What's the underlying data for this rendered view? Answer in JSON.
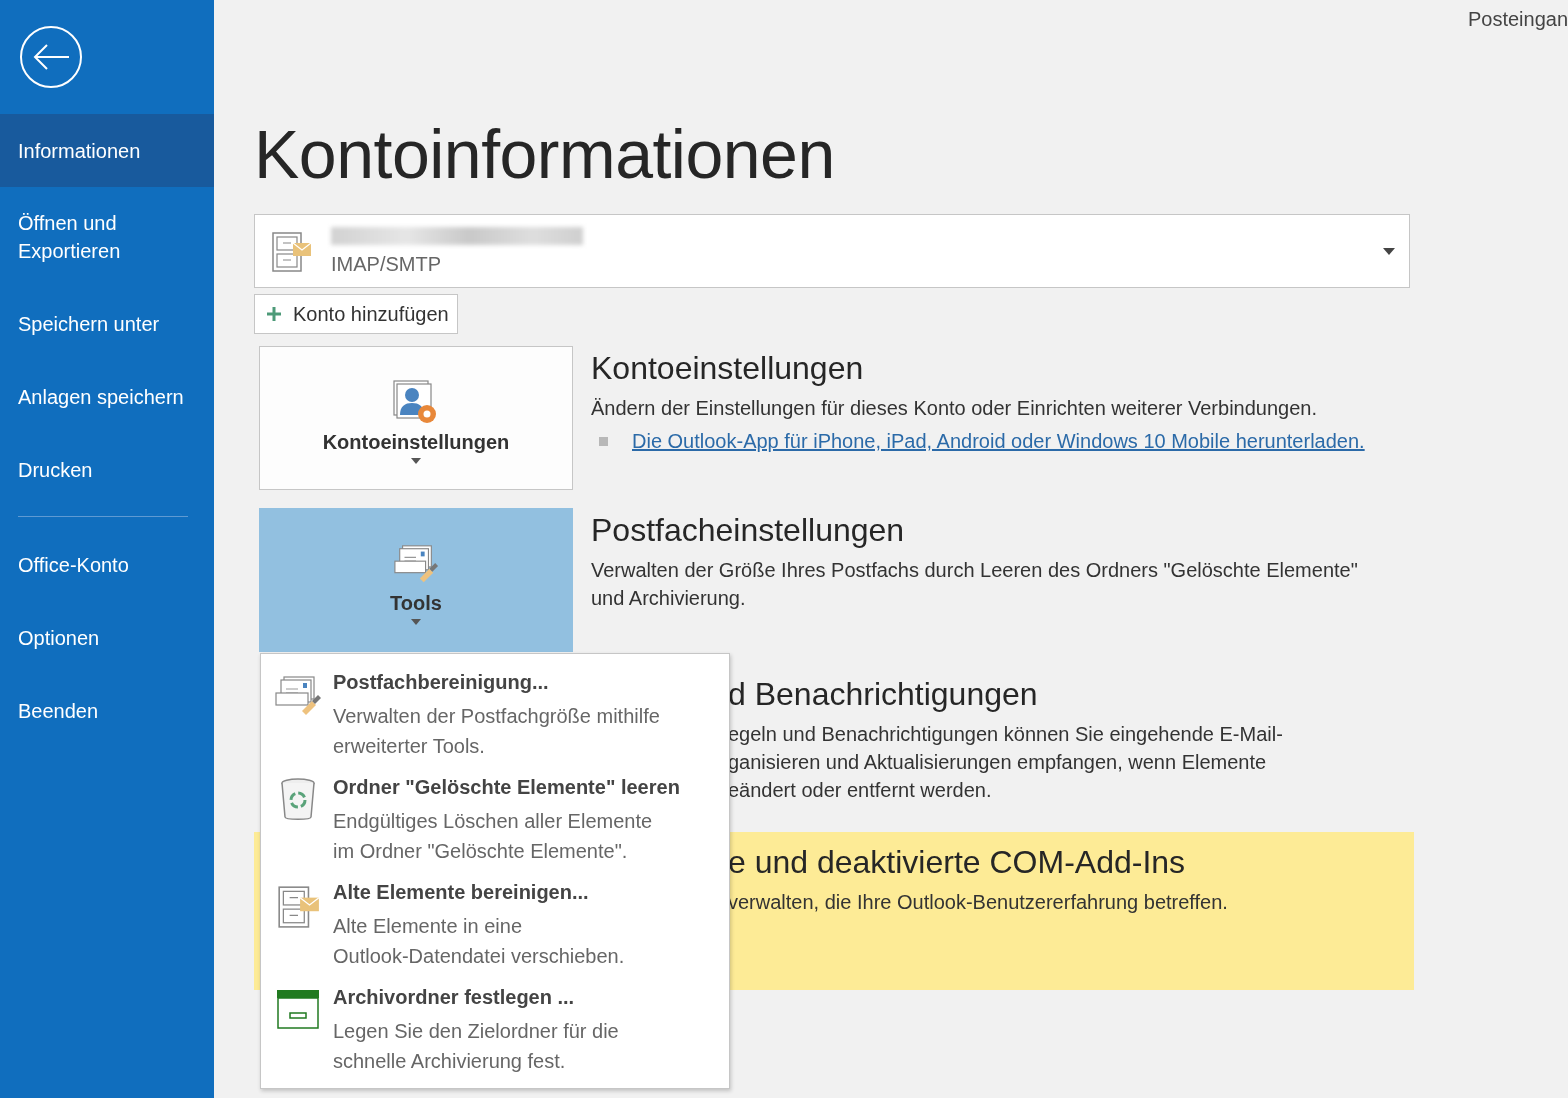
{
  "header": {
    "folder": "Posteingan"
  },
  "sidebar": {
    "items": [
      {
        "label": "Informationen",
        "selected": true
      },
      {
        "label": "Öffnen und Exportieren",
        "selected": false
      },
      {
        "label": "Speichern unter",
        "selected": false
      },
      {
        "label": "Anlagen speichern",
        "selected": false
      },
      {
        "label": "Drucken",
        "selected": false
      }
    ],
    "secondary_items": [
      {
        "label": "Office-Konto",
        "selected": false
      },
      {
        "label": "Optionen",
        "selected": false
      },
      {
        "label": "Beenden",
        "selected": false
      }
    ]
  },
  "page_title": "Kontoinformationen",
  "account": {
    "type": "IMAP/SMTP"
  },
  "add_account": {
    "label": "Konto hinzufügen"
  },
  "sections": [
    {
      "kind": "tile",
      "tile_label": "Kontoeinstellungen",
      "tile_selected": false,
      "heading": "Kontoeinstellungen",
      "description_lines": [
        "Ändern der Einstellungen für dieses Konto oder Einrichten weiterer Verbindungen."
      ],
      "links": [
        "Die Outlook-App für iPhone, iPad, Android oder Windows 10 Mobile herunterladen."
      ]
    },
    {
      "kind": "tile",
      "tile_label": "Tools",
      "tile_selected": true,
      "heading": "Postfacheinstellungen",
      "description_lines": [
        "Verwalten der Größe Ihres Postfachs durch Leeren des Ordners \"Gelöschte Elemente\"",
        "und Archivierung."
      ]
    },
    {
      "kind": "covered",
      "highlight": false,
      "heading": "d Benachrichtigungen",
      "description_lines": [
        "egeln und Benachrichtigungen können Sie eingehende E-Mail-",
        "ganisieren und Aktualisierungen empfangen, wenn Elemente",
        "eändert oder entfernt werden."
      ]
    },
    {
      "kind": "covered",
      "highlight": true,
      "heading": "e und deaktivierte COM-Add-Ins",
      "description_lines": [
        "verwalten, die Ihre Outlook-Benutzererfahrung betreffen."
      ]
    }
  ],
  "tools_menu": {
    "items": [
      {
        "title": "Postfachbereinigung...",
        "description_lines": [
          "Verwalten der Postfachgröße mithilfe",
          "erweiterter Tools."
        ]
      },
      {
        "title": "Ordner \"Gelöschte Elemente\" leeren",
        "description_lines": [
          "Endgültiges Löschen aller Elemente",
          "im Ordner \"Gelöschte Elemente\"."
        ]
      },
      {
        "title": "Alte Elemente bereinigen...",
        "description_lines": [
          "Alte Elemente in eine",
          "Outlook-Datendatei verschieben."
        ]
      },
      {
        "title": "Archivordner festlegen ...",
        "description_lines": [
          "Legen Sie den Zielordner für die",
          "schnelle Archivierung fest."
        ]
      }
    ]
  }
}
